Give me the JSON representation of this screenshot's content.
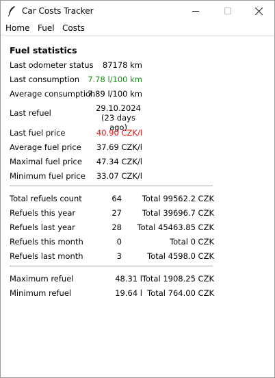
{
  "window": {
    "title": "Car Costs Tracker",
    "controls": {
      "minimize_icon": "minimize-icon",
      "maximize_icon": "maximize-icon",
      "close_icon": "close-icon"
    }
  },
  "menu": {
    "items": [
      "Home",
      "Fuel",
      "Costs"
    ]
  },
  "stats": {
    "heading": "Fuel statistics",
    "odometer": {
      "label": "Last odometer status",
      "value": "87178 km"
    },
    "last_consumption": {
      "label": "Last consumption",
      "value": "7.78 l/100 km",
      "color": "#1a8f1a"
    },
    "avg_consumption": {
      "label": "Average consumption",
      "value": "7.89 l/100 km"
    },
    "last_refuel": {
      "label": "Last refuel",
      "date": "29.10.2024",
      "ago": "(23 days ago)"
    },
    "last_price": {
      "label": "Last fuel price",
      "value": "40.90 CZK/l",
      "color": "#e01010"
    },
    "avg_price": {
      "label": "Average fuel price",
      "value": "37.69 CZK/l"
    },
    "max_price": {
      "label": "Maximal fuel price",
      "value": "47.34 CZK/l"
    },
    "min_price": {
      "label": "Minimum fuel price",
      "value": "33.07 CZK/l"
    }
  },
  "refuels": [
    {
      "label": "Total refuels count",
      "count": "64",
      "total": "Total 99562.2 CZK"
    },
    {
      "label": "Refuels this year",
      "count": "27",
      "total": "Total 39696.7 CZK"
    },
    {
      "label": "Refuels last year",
      "count": "28",
      "total": "Total 45463.85 CZK"
    },
    {
      "label": "Refuels this month",
      "count": "0",
      "total": "Total 0 CZK"
    },
    {
      "label": "Refuels last month",
      "count": "3",
      "total": "Total 4598.0 CZK"
    }
  ],
  "extremes": [
    {
      "label": "Maximum refuel",
      "volume": "48.31 l",
      "total": "Total 1908.25 CZK"
    },
    {
      "label": "Minimum refuel",
      "volume": "19.64 l",
      "total": "Total 764.00 CZK"
    }
  ]
}
